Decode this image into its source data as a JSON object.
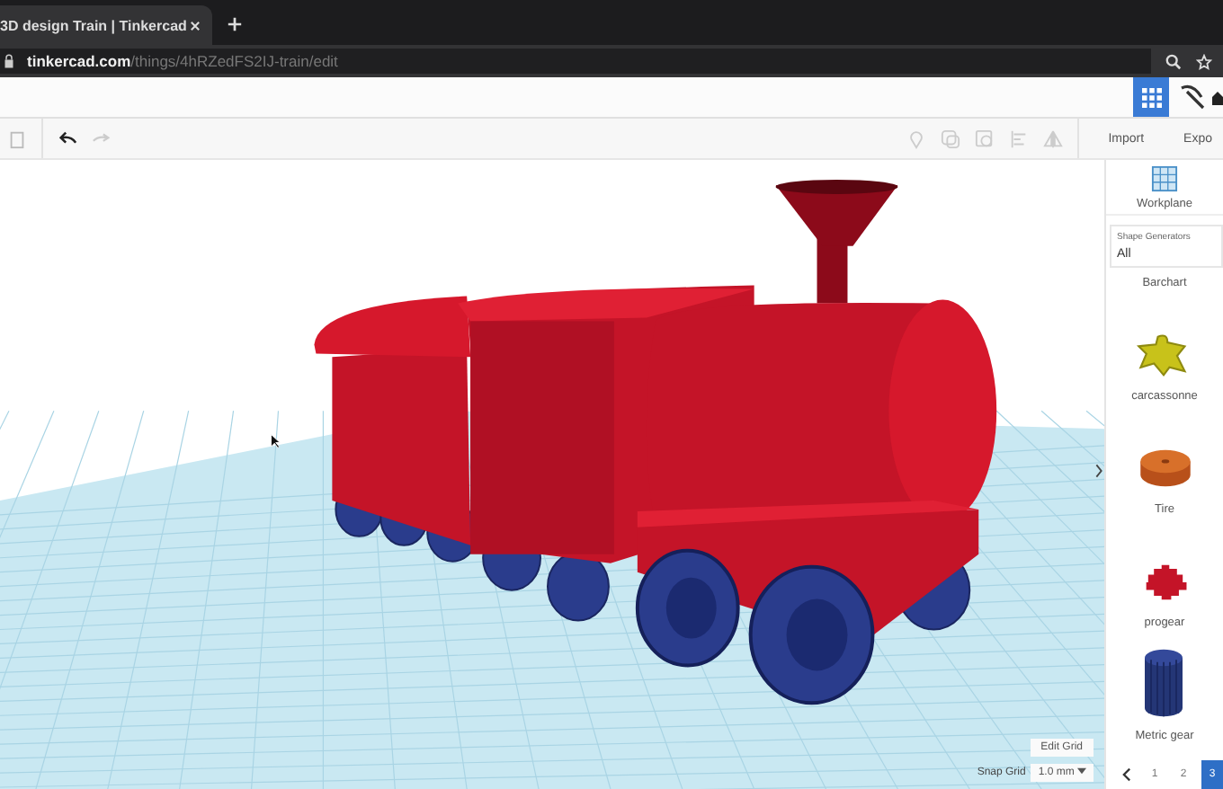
{
  "browser": {
    "tab_title": "3D design Train | Tinkercad",
    "url_domain": "tinkercad.com",
    "url_path": "/things/4hRZedFS2IJ-train/edit"
  },
  "toolbar": {
    "buttons": [
      "Import",
      "Expo"
    ]
  },
  "sidebar": {
    "workplane": "Workplane",
    "shape_generators": {
      "label": "Shape Generators",
      "value": "All"
    },
    "shapes": [
      {
        "name": "Barchart",
        "kind": "none"
      },
      {
        "name": "carcassonne",
        "kind": "meeple"
      },
      {
        "name": "Tire",
        "kind": "tire"
      },
      {
        "name": "progear",
        "kind": "gear"
      },
      {
        "name": "Metric gear",
        "kind": "cylinder"
      }
    ],
    "pages": [
      {
        "label": "1",
        "selected": false
      },
      {
        "label": "2",
        "selected": false
      },
      {
        "label": "3",
        "selected": true
      }
    ]
  },
  "canvas": {
    "edit_grid": "Edit Grid",
    "snap_grid_label": "Snap Grid",
    "snap_grid_value": "1.0 mm"
  }
}
